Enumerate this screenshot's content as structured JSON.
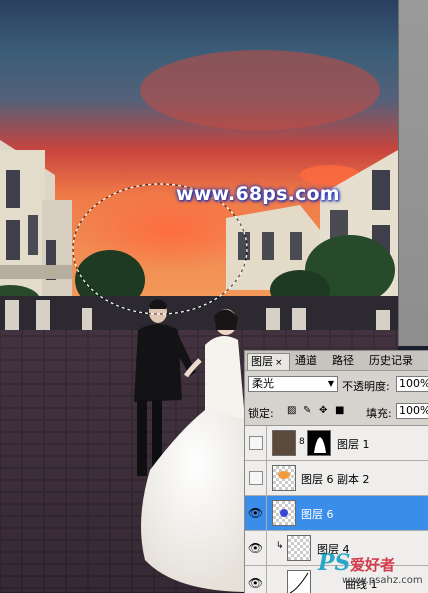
{
  "watermark": {
    "url": "www.68ps.com"
  },
  "layers_panel": {
    "tabs": [
      {
        "label": "图层",
        "close": "×"
      },
      {
        "label": "通道"
      },
      {
        "label": "路径"
      },
      {
        "label": "历史记录"
      }
    ],
    "blend_mode": "柔光",
    "opacity_label": "不透明度:",
    "opacity_value": "100%",
    "lock_label": "锁定:",
    "fill_label": "填充:",
    "fill_value": "100%",
    "layers": [
      {
        "name": "图层 1",
        "visible": false,
        "selected": false
      },
      {
        "name": "图层 6 副本 2",
        "visible": false,
        "selected": false
      },
      {
        "name": "图层 6",
        "visible": true,
        "selected": true
      },
      {
        "name": "图层 4",
        "visible": true,
        "selected": false
      },
      {
        "name": "曲线 1",
        "visible": true,
        "selected": false
      }
    ]
  },
  "site_watermark": {
    "logo": "PS",
    "name": "爱好者",
    "url": "www.psahz.com"
  }
}
